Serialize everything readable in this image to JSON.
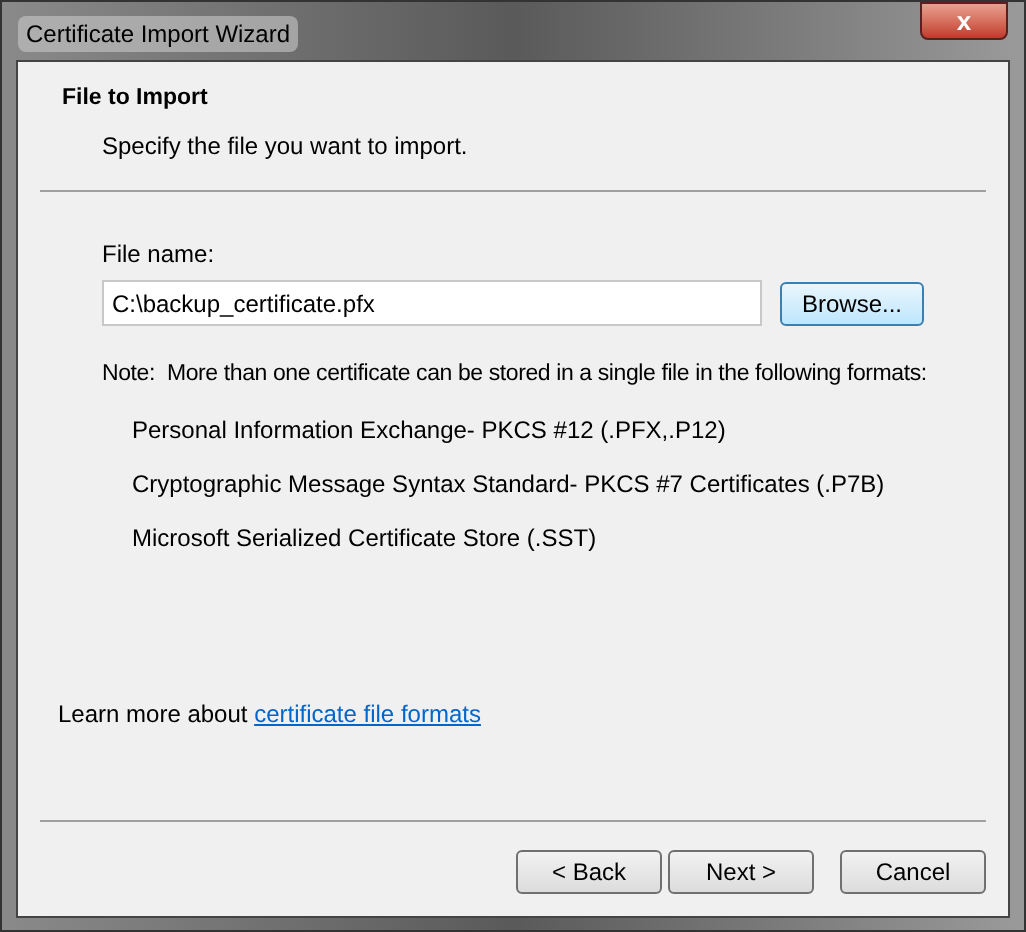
{
  "window": {
    "title": "Certificate Import Wizard",
    "close": "x"
  },
  "header": {
    "title": "File to Import",
    "subtitle": "Specify the file you want to import."
  },
  "file": {
    "label": "File name:",
    "value": "C:\\backup_certificate.pfx",
    "browse": "Browse..."
  },
  "note": "Note:  More than one certificate can be stored in a single file in the following formats:",
  "formats": [
    "Personal Information Exchange- PKCS #12 (.PFX,.P12)",
    "Cryptographic Message Syntax Standard- PKCS #7 Certificates (.P7B)",
    "Microsoft Serialized Certificate Store (.SST)"
  ],
  "learn_more": {
    "text": "Learn more about",
    "link": "certificate file formats"
  },
  "buttons": [
    "< Back",
    "Next >",
    "Cancel"
  ]
}
